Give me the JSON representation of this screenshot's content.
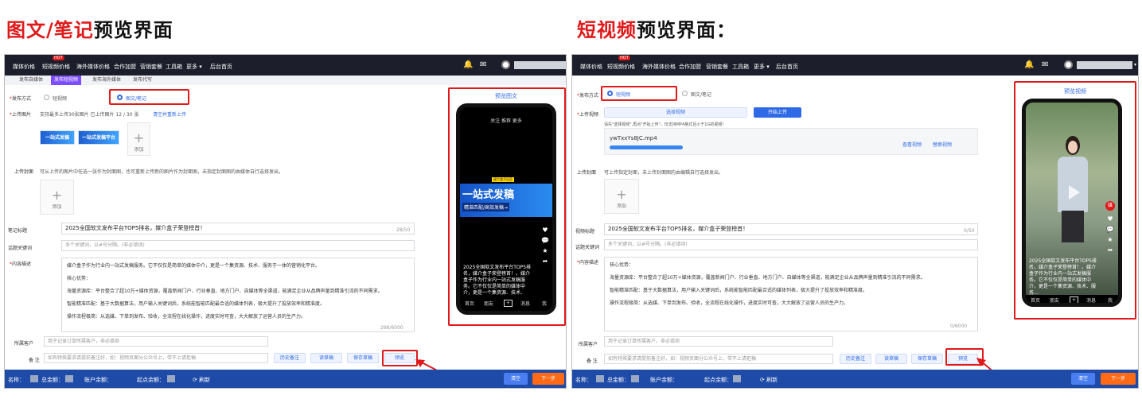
{
  "left_heading": {
    "red": "图文/笔记",
    "black": "预览界面"
  },
  "right_heading": {
    "red": "短视频",
    "black": "预览界面："
  },
  "nav": {
    "hot_badge": "HOT",
    "items_left": [
      "媒体价格",
      "短视频价格",
      "海外媒体价格",
      "合作加盟",
      "营销套餐",
      "工具箱",
      "更多 ▾",
      "后台首页"
    ],
    "items_right": [
      "媒体价格",
      "短视频价格",
      "海外媒体价格",
      "合作加盟",
      "营销套餐",
      "工具箱",
      "更多 ▾",
      "后台首页"
    ],
    "bell_icon": "🔔",
    "mail_icon": "✉"
  },
  "tabs": [
    "发布自媒体",
    "发布短视频",
    "发布海外媒体",
    "发布代写"
  ],
  "left": {
    "publish_way_label": "发布方式",
    "option_video": "短视频",
    "option_note": "图文/笔记",
    "upload_image_label": "上传图片",
    "upload_image_hint": "支持最多上传30张图片   已上传图片 12 / 30 张",
    "clear_reupload": "清空并重新上传",
    "thumb1": "一站式发稿",
    "thumb2": "一站式发稿平台",
    "add_label": "添加",
    "cover_label": "上传封面",
    "cover_hint": "可从上传的图片中任选一张作为封面图，也可重新上传新的图片作为封面图，未指定封面图的由媒体自行选择发出。",
    "title_label": "笔记标题",
    "title_value": "2025全国软文发布平台TOP5排名，媒介盒子荣登榜首！",
    "title_counter": "28/50",
    "keyword_label": "话题关键词",
    "keyword_placeholder": "多个关键词，以#号分隔。(非必填项)",
    "desc_label": "内容描述",
    "desc_lines": [
      "媒介盒子作为行业内一站式发稿服务。它不仅仅是简单的媒体中介，更是一个集资源、技术、服务于一体的营销化平台。",
      "核心优势：",
      "海量资源库：平台整合了超10万+媒体资源，覆盖新闻门户、行业垂直、地方门户、自媒体等全渠道，能满足企业从品牌声量到精准引流的不同需求。",
      "智能精准匹配：基于大数据算法，用户输入关键词后，系统能智能匹配最合适的媒体列表，极大提升了投放效率和精准度。",
      "操作流程极简：从选媒、下单到发布、验收，全流程在线化操作，进度实时可查，大大解放了运营人员的生产力。"
    ],
    "desc_counter": "298/6000",
    "client_label": "所属客户",
    "client_placeholder": "用于记录订单所属客户，非必填项",
    "remark_label": "备 注",
    "remark_placeholder": "如有特殊要求请提前备注好，如：视频页面分公众号上，带不上请拒稿",
    "btn_history": "历史备注",
    "btn_draft": "读草稿",
    "btn_save": "保存草稿",
    "btn_preview": "预览",
    "preview_title": "预览图文",
    "phone_tabs": "关注   推荐   更多",
    "phone_banner_tag": "媒介盒子出品",
    "phone_banner_main": "一站式发稿",
    "phone_banner_sub": "精准匹配/高效发稿→",
    "phone_caption": "2025全国软文发布平台TOP5排名，媒介盒子荣登榜首！。媒介盒子作为行业内一站式发稿服务。它不仅仅是简单的媒体中介，更是一个集资源、技术、",
    "phone_bottom": [
      "首页",
      "朋友",
      "+",
      "消息",
      "我"
    ]
  },
  "right": {
    "publish_way_label": "发布方式",
    "option_video": "短视频",
    "option_note": "图文/笔记",
    "upload_video_label": "上传视频",
    "btn_choose_video": "选择视频",
    "btn_start_upload": "开始上传",
    "upload_hint": "请先\"选择视频\",再点\"开始上传\"，仅支持MP4格式且小于1G的视频!",
    "file_name": "ywTxxYs8JC.mp4",
    "view_video": "查看视频",
    "replace_video": "替换视频",
    "cover_label": "上传封面",
    "cover_hint": "可上传指定封面，未上传封面图的由编辑自行选择发出。",
    "add_label": "添加",
    "title_label": "视频标题",
    "title_value": "2025全国软文发布平台TOP5排名，媒介盒子荣登榜首！",
    "title_counter": "0/50",
    "keyword_label": "话题关键词",
    "keyword_placeholder": "多个关键词，以#号分隔。(非必填项)",
    "desc_label": "内容描述",
    "desc_lines": [
      "核心优势：",
      "海量资源库：平台整合了超10万+媒体资源，覆盖新闻门户、行业垂直、地方门户、自媒体等全渠道，能满足企业从品牌声量到精准引流的不同需求。",
      "智能精准匹配：基于大数据算法，用户输入关键词后，系统能智能匹配最合适的媒体列表，极大提升了投放效率和精准度。",
      "操作流程极简：从选媒、下单到发布、验收，全流程在线化操作，进度实时可查，大大解放了运营人员的生产力。"
    ],
    "desc_counter": "0/6000",
    "client_label": "所属客户",
    "client_placeholder": "用于记录订单所属客户，非必填项",
    "remark_label": "备 注",
    "remark_placeholder": "如有特殊要求请提前备注好，如：视频页面分公众号上，带不上请拒稿",
    "btn_history": "历史备注",
    "btn_draft": "读草稿",
    "btn_save": "保存草稿",
    "btn_preview": "预览",
    "preview_title": "预览视频",
    "phone_caption": "2025全国软文发布平台TOP5排名，媒介盒子荣登榜首！。媒介盒子作为行业内一站式发稿服务。它不仅仅是简单的媒体中介，更是一个集资源、技术、服务...",
    "phone_bottom": [
      "首页",
      "朋友",
      "+",
      "消息",
      "我"
    ]
  },
  "bottom": {
    "name": "名称：",
    "total": "总金额：",
    "account": "账户余额：",
    "start": "起点余额：",
    "refresh": "⟳ 刷新",
    "clear": "清空",
    "next": "下一步"
  }
}
